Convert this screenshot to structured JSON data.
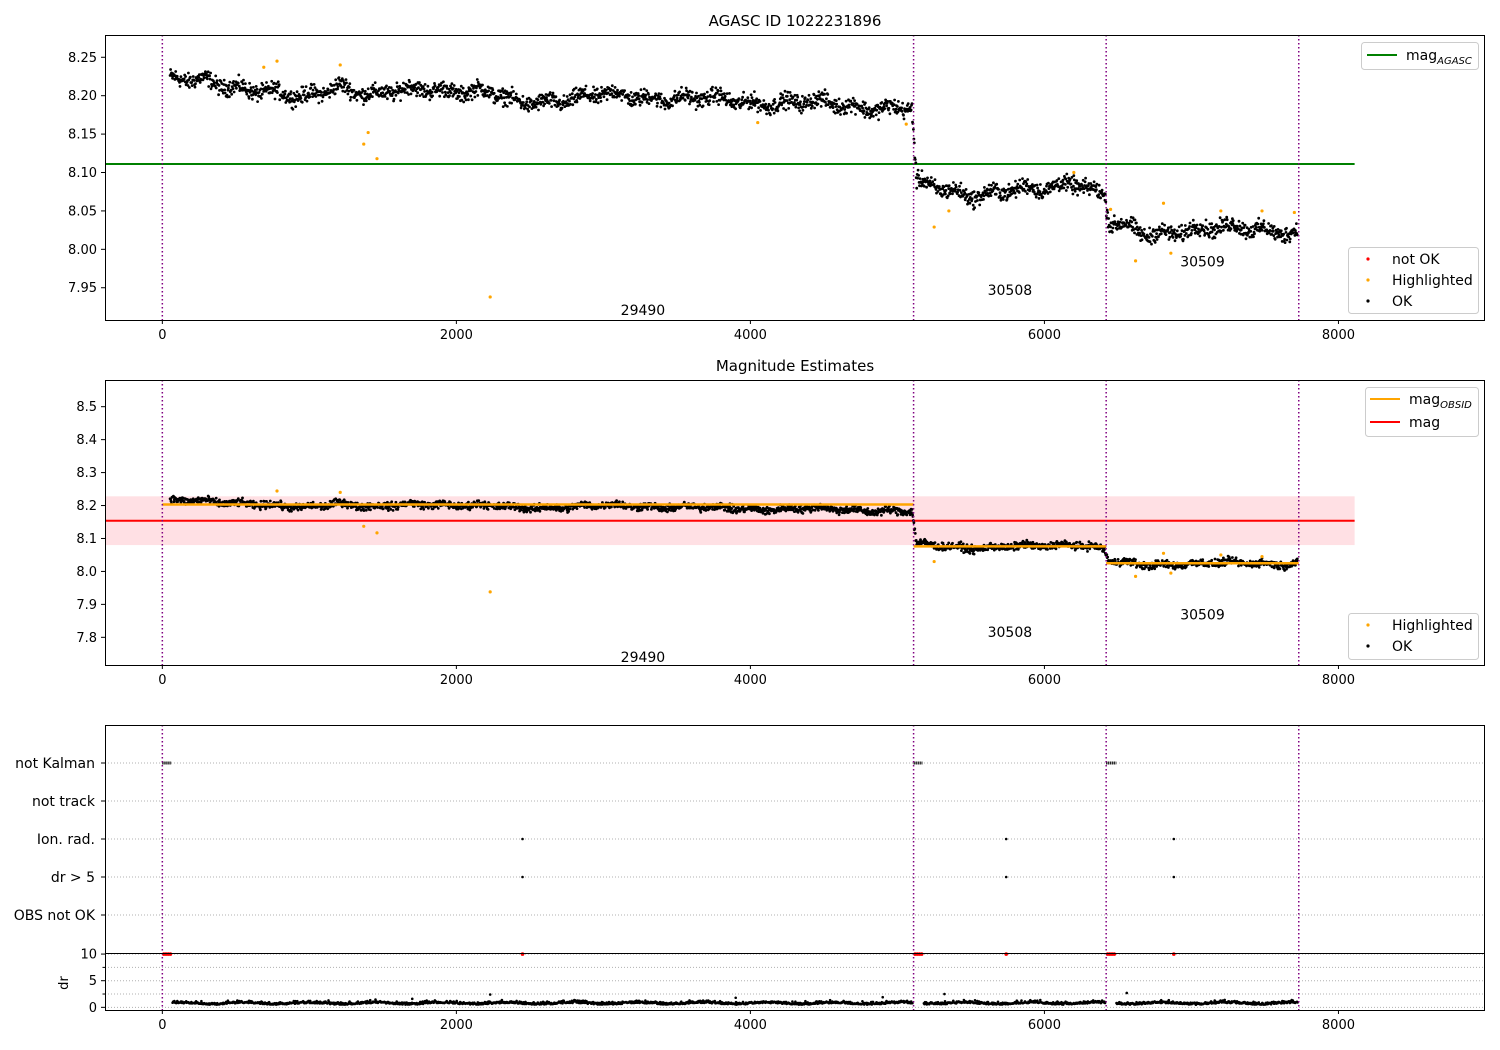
{
  "colors": {
    "ok": "#000000",
    "highlighted": "#ffa500",
    "not_ok": "#ff0000",
    "mag_agasc": "#008000",
    "mag_obsid": "#ffa500",
    "mag": "#ff0000",
    "mag_band": "#ffe0e4",
    "obs_boundary": "#800080",
    "flag_grid": "#b0b0b0"
  },
  "obs_boundaries": [
    0,
    5110,
    6420,
    7730
  ],
  "observations": [
    {
      "obsid": "29490",
      "x_start": 0,
      "x_end": 5110,
      "mag_obsid": 8.203
    },
    {
      "obsid": "30508",
      "x_start": 5110,
      "x_end": 6420,
      "mag_obsid": 8.076
    },
    {
      "obsid": "30509",
      "x_start": 6420,
      "x_end": 7730,
      "mag_obsid": 8.025
    }
  ],
  "chart_data": [
    {
      "type": "scatter",
      "title": "AGASC ID 1022231896",
      "xlim": [
        -390,
        8990
      ],
      "ylim": [
        7.908,
        8.279
      ],
      "xticks": [
        "0",
        "2000",
        "4000",
        "6000",
        "8000"
      ],
      "yticks": [
        "7.95",
        "8.00",
        "8.05",
        "8.10",
        "8.15",
        "8.20",
        "8.25"
      ],
      "hline": {
        "name": "mag",
        "sub": "AGASC",
        "y": 8.111,
        "x_range": [
          -390,
          8110
        ]
      },
      "legend_lines": [
        {
          "name": "mag",
          "sub": "AGASC"
        }
      ],
      "legend_markers": [
        "not OK",
        "Highlighted",
        "OK"
      ],
      "obs_label_y": [
        7.921,
        7.947,
        7.984
      ],
      "ok_trend": [
        {
          "x": 50,
          "y": 8.22
        },
        {
          "x": 300,
          "y": 8.218
        },
        {
          "x": 600,
          "y": 8.21
        },
        {
          "x": 950,
          "y": 8.195
        },
        {
          "x": 1200,
          "y": 8.215
        },
        {
          "x": 1450,
          "y": 8.2
        },
        {
          "x": 1800,
          "y": 8.21
        },
        {
          "x": 2200,
          "y": 8.205
        },
        {
          "x": 2400,
          "y": 8.19
        },
        {
          "x": 3000,
          "y": 8.2
        },
        {
          "x": 3400,
          "y": 8.198
        },
        {
          "x": 4000,
          "y": 8.192
        },
        {
          "x": 4500,
          "y": 8.19
        },
        {
          "x": 5100,
          "y": 8.182
        },
        {
          "x": 5130,
          "y": 8.085
        },
        {
          "x": 5500,
          "y": 8.072
        },
        {
          "x": 6000,
          "y": 8.078
        },
        {
          "x": 6200,
          "y": 8.09
        },
        {
          "x": 6410,
          "y": 8.07
        },
        {
          "x": 6440,
          "y": 8.035
        },
        {
          "x": 6700,
          "y": 8.018
        },
        {
          "x": 7000,
          "y": 8.028
        },
        {
          "x": 7400,
          "y": 8.026
        },
        {
          "x": 7720,
          "y": 8.024
        }
      ],
      "ok_spread": 0.009,
      "highlighted": [
        {
          "x": 690,
          "y": 8.237
        },
        {
          "x": 780,
          "y": 8.245
        },
        {
          "x": 1210,
          "y": 8.24
        },
        {
          "x": 1370,
          "y": 8.137
        },
        {
          "x": 1400,
          "y": 8.152
        },
        {
          "x": 1460,
          "y": 8.118
        },
        {
          "x": 2230,
          "y": 7.938
        },
        {
          "x": 4050,
          "y": 8.165
        },
        {
          "x": 5060,
          "y": 8.163
        },
        {
          "x": 5250,
          "y": 8.029
        },
        {
          "x": 5350,
          "y": 8.05
        },
        {
          "x": 6200,
          "y": 8.1
        },
        {
          "x": 6450,
          "y": 8.052
        },
        {
          "x": 6620,
          "y": 7.985
        },
        {
          "x": 6810,
          "y": 8.06
        },
        {
          "x": 6860,
          "y": 7.995
        },
        {
          "x": 7200,
          "y": 8.05
        },
        {
          "x": 7480,
          "y": 8.05
        },
        {
          "x": 7700,
          "y": 8.048
        }
      ]
    },
    {
      "type": "scatter",
      "title": "Magnitude Estimates",
      "xlim": [
        -390,
        8990
      ],
      "ylim": [
        7.716,
        8.581
      ],
      "xticks": [
        "0",
        "2000",
        "4000",
        "6000",
        "8000"
      ],
      "yticks": [
        "7.8",
        "7.9",
        "8.0",
        "8.1",
        "8.2",
        "8.3",
        "8.4",
        "8.5"
      ],
      "hline": {
        "name": "mag",
        "y": 8.154,
        "x_range": [
          -390,
          8110
        ]
      },
      "band": {
        "y_low": 8.08,
        "y_high": 8.228,
        "x_range": [
          -390,
          8110
        ]
      },
      "legend_lines": [
        {
          "name": "mag",
          "sub": "OBSID"
        },
        {
          "name": "mag"
        }
      ],
      "legend_markers": [
        "Highlighted",
        "OK"
      ],
      "obs_label_y": [
        7.74,
        7.816,
        7.87
      ],
      "ok_trend": [
        {
          "x": 50,
          "y": 8.215
        },
        {
          "x": 300,
          "y": 8.212
        },
        {
          "x": 600,
          "y": 8.207
        },
        {
          "x": 950,
          "y": 8.19
        },
        {
          "x": 1200,
          "y": 8.21
        },
        {
          "x": 1450,
          "y": 8.195
        },
        {
          "x": 1800,
          "y": 8.205
        },
        {
          "x": 2200,
          "y": 8.2
        },
        {
          "x": 2400,
          "y": 8.192
        },
        {
          "x": 3000,
          "y": 8.2
        },
        {
          "x": 3400,
          "y": 8.197
        },
        {
          "x": 4000,
          "y": 8.19
        },
        {
          "x": 4500,
          "y": 8.19
        },
        {
          "x": 5100,
          "y": 8.182
        },
        {
          "x": 5130,
          "y": 8.082
        },
        {
          "x": 5500,
          "y": 8.072
        },
        {
          "x": 6000,
          "y": 8.076
        },
        {
          "x": 6200,
          "y": 8.085
        },
        {
          "x": 6410,
          "y": 8.068
        },
        {
          "x": 6440,
          "y": 8.03
        },
        {
          "x": 6700,
          "y": 8.018
        },
        {
          "x": 7000,
          "y": 8.026
        },
        {
          "x": 7400,
          "y": 8.024
        },
        {
          "x": 7720,
          "y": 8.024
        }
      ],
      "ok_spread": 0.01,
      "highlighted": [
        {
          "x": 780,
          "y": 8.244
        },
        {
          "x": 1210,
          "y": 8.24
        },
        {
          "x": 1370,
          "y": 8.137
        },
        {
          "x": 1460,
          "y": 8.117
        },
        {
          "x": 2230,
          "y": 7.938
        },
        {
          "x": 5250,
          "y": 8.03
        },
        {
          "x": 6620,
          "y": 7.985
        },
        {
          "x": 6810,
          "y": 8.055
        },
        {
          "x": 6860,
          "y": 7.995
        },
        {
          "x": 7200,
          "y": 8.05
        },
        {
          "x": 7480,
          "y": 8.045
        }
      ]
    },
    {
      "type": "scatter",
      "title": "",
      "xlim": [
        -390,
        8990
      ],
      "categories": [
        "not Kalman",
        "not track",
        "Ion. rad.",
        "dr > 5",
        "OBS not OK"
      ],
      "flags": [
        {
          "category": "not Kalman",
          "x_ranges": [
            [
              0,
              60
            ],
            [
              5110,
              5170
            ],
            [
              6420,
              6490
            ]
          ]
        },
        {
          "category": "Ion. rad.",
          "x": [
            2450,
            5740,
            6880
          ]
        },
        {
          "category": "dr > 5",
          "x": [
            2450,
            5740,
            6880
          ]
        }
      ]
    },
    {
      "type": "scatter",
      "title": "",
      "xlim": [
        -390,
        8990
      ],
      "ylim": [
        -0.5,
        10.2
      ],
      "ylabel": "dr",
      "xticks": [
        "0",
        "2000",
        "4000",
        "6000",
        "8000"
      ],
      "yticks": [
        "0",
        "5",
        "10"
      ],
      "ok_mean": 0.8,
      "ok_spread": 0.45,
      "ok_outliers": [
        {
          "x": 2230,
          "y": 2.4
        },
        {
          "x": 4900,
          "y": 1.9
        },
        {
          "x": 5320,
          "y": 2.5
        },
        {
          "x": 6560,
          "y": 2.7
        },
        {
          "x": 3900,
          "y": 1.8
        },
        {
          "x": 1700,
          "y": 1.6
        }
      ],
      "not_ok": [
        {
          "x": 10,
          "y": 10
        },
        {
          "x": 25,
          "y": 10
        },
        {
          "x": 40,
          "y": 10
        },
        {
          "x": 55,
          "y": 10
        },
        {
          "x": 2450,
          "y": 10
        },
        {
          "x": 5120,
          "y": 10
        },
        {
          "x": 5135,
          "y": 10
        },
        {
          "x": 5150,
          "y": 10
        },
        {
          "x": 5165,
          "y": 10
        },
        {
          "x": 5740,
          "y": 10
        },
        {
          "x": 6430,
          "y": 10
        },
        {
          "x": 6445,
          "y": 10
        },
        {
          "x": 6460,
          "y": 10
        },
        {
          "x": 6475,
          "y": 10
        },
        {
          "x": 6880,
          "y": 10
        }
      ]
    }
  ]
}
